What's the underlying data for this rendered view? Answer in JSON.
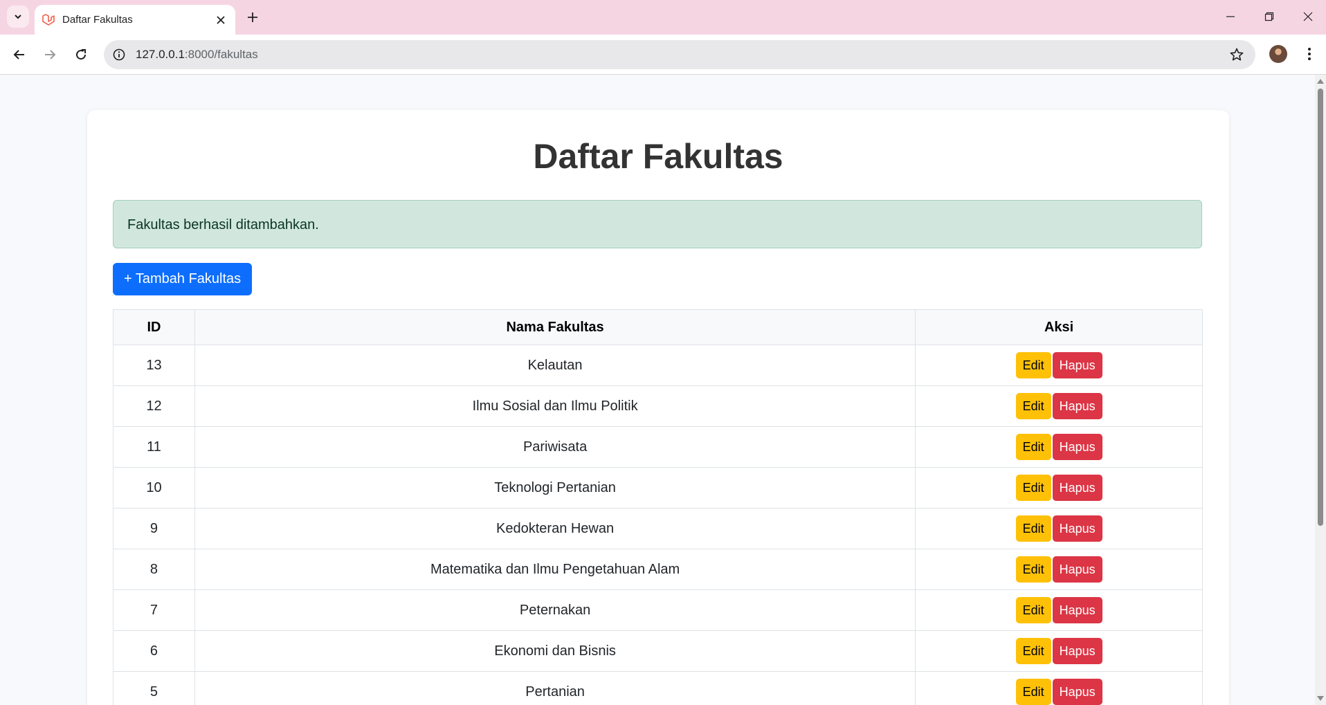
{
  "browser": {
    "tab_title": "Daftar Fakultas",
    "url_host": "127.0.0.1",
    "url_path": ":8000/fakultas"
  },
  "page": {
    "title": "Daftar Fakultas",
    "alert": "Fakultas berhasil ditambahkan.",
    "add_button": "+ Tambah Fakultas",
    "table": {
      "headers": [
        "ID",
        "Nama Fakultas",
        "Aksi"
      ],
      "edit_label": "Edit",
      "delete_label": "Hapus",
      "rows": [
        {
          "id": "13",
          "name": "Kelautan"
        },
        {
          "id": "12",
          "name": "Ilmu Sosial dan Ilmu Politik"
        },
        {
          "id": "11",
          "name": "Pariwisata"
        },
        {
          "id": "10",
          "name": "Teknologi Pertanian"
        },
        {
          "id": "9",
          "name": "Kedokteran Hewan"
        },
        {
          "id": "8",
          "name": "Matematika dan Ilmu Pengetahuan Alam"
        },
        {
          "id": "7",
          "name": "Peternakan"
        },
        {
          "id": "6",
          "name": "Ekonomi dan Bisnis"
        },
        {
          "id": "5",
          "name": "Pertanian"
        }
      ]
    }
  },
  "colors": {
    "tabstrip": "#f6d5e2",
    "primary": "#0d6efd",
    "warning": "#ffc107",
    "danger": "#dc3545",
    "alert_bg": "#d1e7dd"
  },
  "icons": [
    "tab-search-icon",
    "laravel-favicon-icon",
    "close-icon",
    "plus-icon",
    "minimize-icon",
    "restore-icon",
    "window-close-icon",
    "back-icon",
    "forward-icon",
    "reload-icon",
    "site-info-icon",
    "bookmark-star-icon",
    "kebab-menu-icon"
  ]
}
